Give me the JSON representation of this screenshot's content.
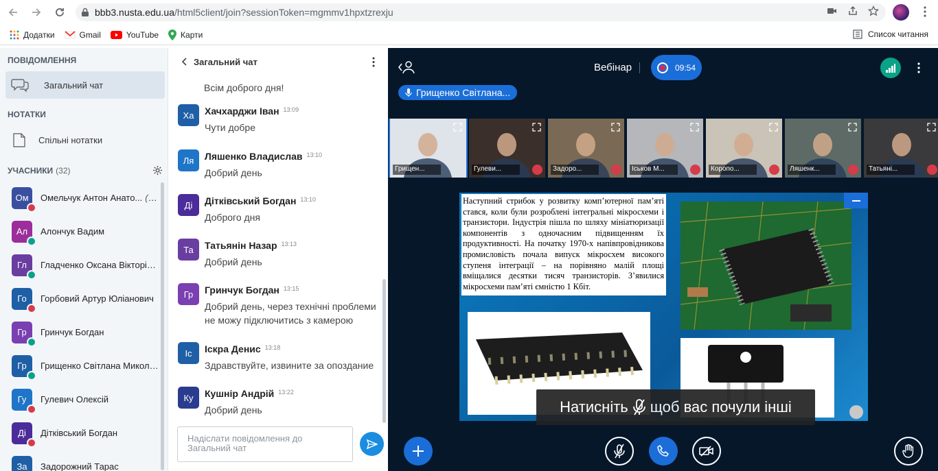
{
  "browser": {
    "url_host": "bbb3.nusta.edu.ua",
    "url_path": "/html5client/join?sessionToken=mgmmv1hpxtzrexju",
    "bookmarks": [
      "Додатки",
      "Gmail",
      "YouTube",
      "Карти"
    ],
    "reading_list": "Список читання"
  },
  "sidebar": {
    "messages_header": "ПОВІДОМЛЕННЯ",
    "public_chat": "Загальний чат",
    "notes_header": "НОТАТКИ",
    "shared_notes": "Спільні нотатки",
    "users_header": "УЧАСНИКИ",
    "users_count": "(32)",
    "users": [
      {
        "initials": "Ом",
        "name": "Омельчук Антон Анато...",
        "you": "(Ви)",
        "color": "#3a4f9e",
        "status": "muted"
      },
      {
        "initials": "Ал",
        "name": "Алончук Вадим",
        "color": "#9b2e9b",
        "status": "listen"
      },
      {
        "initials": "Гл",
        "name": "Гладченко Оксана Вікторів...",
        "color": "#6a3ea1",
        "status": "listen"
      },
      {
        "initials": "Го",
        "name": "Горбовий Артур Юліанович",
        "color": "#1f5fa6",
        "status": "muted"
      },
      {
        "initials": "Гр",
        "name": "Гринчук Богдан",
        "color": "#7a3fb0",
        "status": "listen"
      },
      {
        "initials": "Гр",
        "name": "Грищенко Світлана Микола...",
        "color": "#1f5fa6",
        "status": "talk"
      },
      {
        "initials": "Гу",
        "name": "Гулевич Олексій",
        "color": "#1f75c7",
        "status": "muted"
      },
      {
        "initials": "Ді",
        "name": "Дітківський Богдан",
        "color": "#4b2c9a",
        "status": "muted"
      },
      {
        "initials": "За",
        "name": "Задорожний Тарас",
        "color": "#1f5fa6",
        "status": "none"
      }
    ]
  },
  "chat": {
    "title": "Загальний чат",
    "first_cut": "Всім доброго дня!",
    "messages": [
      {
        "initials": "Ха",
        "name": "Хачхарджи Іван",
        "time": "13:09",
        "text": "Чути добре",
        "color": "#1f5fa6"
      },
      {
        "initials": "Ля",
        "name": "Ляшенко Владислав",
        "time": "13:10",
        "text": "Добрий день",
        "color": "#1f75c7"
      },
      {
        "initials": "Ді",
        "name": "Дітківський Богдан",
        "time": "13:10",
        "text": "Доброго дня",
        "color": "#4b2c9a"
      },
      {
        "initials": "Та",
        "name": "Татьянін Назар",
        "time": "13:13",
        "text": "Добрий день",
        "color": "#6a3ea1"
      },
      {
        "initials": "Гр",
        "name": "Гринчук Богдан",
        "time": "13:15",
        "text": "Добрий день, через технічні проблеми не можу підключитись з камерою",
        "color": "#7a3fb0"
      },
      {
        "initials": "Іс",
        "name": "Іскра Денис",
        "time": "13:18",
        "text": "Здравствуйте, извините за опоздание",
        "color": "#1f5fa6"
      },
      {
        "initials": "Ку",
        "name": "Кушнір Андрій",
        "time": "13:22",
        "text": "Добрий день",
        "color": "#2a3c8e"
      }
    ],
    "input_placeholder": "Надіслати повідомлення до Загальний чат"
  },
  "stage": {
    "title": "Вебінар",
    "rec_time": "09:54",
    "talking": "Грищенко Світлана...",
    "tiles": [
      {
        "name": "Грищен...",
        "bg": "#dfe3ea"
      },
      {
        "name": "Гулеви...",
        "bg": "#3b2f2b"
      },
      {
        "name": "Задоро...",
        "bg": "#7a6a55"
      },
      {
        "name": "Іськов М...",
        "bg": "#b5b7bb"
      },
      {
        "name": "Коропо...",
        "bg": "#c9c3b8"
      },
      {
        "name": "Ляшенк...",
        "bg": "#5d6a66"
      },
      {
        "name": "Татьяні...",
        "bg": "#3a3a3c"
      }
    ],
    "slide_text": "Наступний стрибок у розвитку комп’ютерної пам’яті стався, коли були розроблені інтегральні мікросхеми і транзистори. Індустрія пішла по шляху мініатюризації компонентів з одночасним підвищенням їх продуктивності. На початку 1970-х напівпровідникова промисловість почала випуск мікросхем високого ступеня інтеграції – на порівняно малій площі вміщалися десятки тисяч транзисторів. З’явилися мікросхеми пам’яті ємністю 1 Кбіт.",
    "tooltip_left": "Натисніть",
    "tooltip_right": "щоб вас почули інші"
  }
}
